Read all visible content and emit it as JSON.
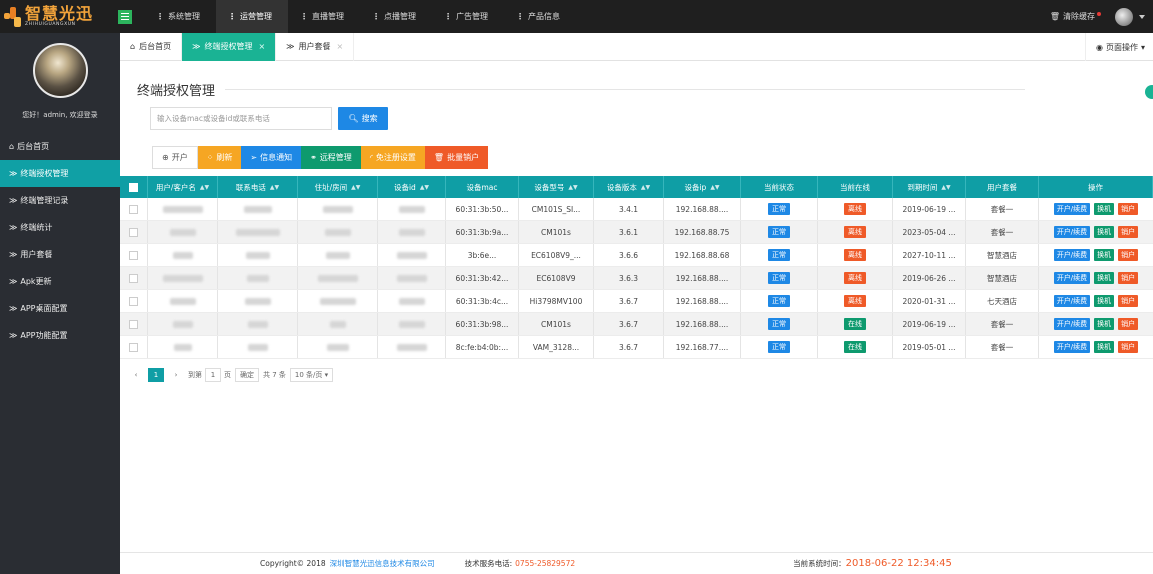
{
  "brand": {
    "name": "智慧光迅",
    "sub": "ZHIHUIGUANGXUN"
  },
  "topnav": [
    {
      "prefix": "⋮",
      "label": "系统管理"
    },
    {
      "prefix": "⋮",
      "label": "运营管理",
      "active": true
    },
    {
      "prefix": "⋮",
      "label": "直播管理"
    },
    {
      "prefix": "⋮",
      "label": "点播管理"
    },
    {
      "prefix": "⋮",
      "label": "广告管理"
    },
    {
      "prefix": "⋮",
      "label": "产品信息"
    }
  ],
  "topright": {
    "clear_cache": "清除缓存"
  },
  "sidebar": {
    "welcome": "您好！admin, 欢迎登录",
    "items": [
      {
        "icon": "home-icon",
        "label": "后台首页",
        "glyph": "⌂"
      },
      {
        "icon": "double-chevron-icon",
        "label": "终端授权管理",
        "glyph": "≫",
        "active": true
      },
      {
        "icon": "double-chevron-icon",
        "label": "终端管理记录",
        "glyph": "≫"
      },
      {
        "icon": "double-chevron-icon",
        "label": "终端统计",
        "glyph": "≫"
      },
      {
        "icon": "double-chevron-icon",
        "label": "用户套餐",
        "glyph": "≫"
      },
      {
        "icon": "double-chevron-icon",
        "label": "Apk更新",
        "glyph": "≫"
      },
      {
        "icon": "double-chevron-icon",
        "label": "APP桌面配置",
        "glyph": "≫"
      },
      {
        "icon": "double-chevron-icon",
        "label": "APP功能配置",
        "glyph": "≫"
      }
    ]
  },
  "tabs": {
    "home": "后台首页",
    "t1": "终端授权管理",
    "t2": "用户套餐",
    "close": "×",
    "page_ops": "页面操作"
  },
  "page": {
    "title": "终端授权管理",
    "search_placeholder": "输入设备mac或设备id或联系电话",
    "search_btn": "搜索"
  },
  "toolbar": {
    "open": "开户",
    "refresh": "刷新",
    "notify": "信息通知",
    "remote": "远程管理",
    "free": "免注册设置",
    "batch": "批量销户"
  },
  "table": {
    "headers": [
      "用户/客户名",
      "联系电话",
      "住址/房间",
      "设备id",
      "设备mac",
      "设备型号",
      "设备版本",
      "设备ip",
      "当前状态",
      "当前在线",
      "到期时间",
      "用户套餐",
      "操作"
    ],
    "rows": [
      {
        "mac": "60:31:3b:50...",
        "model": "CM101S_SI...",
        "ver": "3.4.1",
        "ip": "192.168.88....",
        "status": "正常",
        "online": "离线",
        "online_type": "off",
        "expire": "2019-06-19 ...",
        "plan": "套餐一"
      },
      {
        "mac": "60:31:3b:9a...",
        "model": "CM101s",
        "ver": "3.6.1",
        "ip": "192.168.88.75",
        "status": "正常",
        "online": "离线",
        "online_type": "off",
        "expire": "2023-05-04 ...",
        "plan": "套餐一"
      },
      {
        "mac": "3b:6e...",
        "model": "EC6108V9_...",
        "ver": "3.6.6",
        "ip": "192.168.88.68",
        "status": "正常",
        "online": "离线",
        "online_type": "off",
        "expire": "2027-10-11 ...",
        "plan": "智慧酒店"
      },
      {
        "mac": "60:31:3b:42...",
        "model": "EC6108V9",
        "ver": "3.6.3",
        "ip": "192.168.88....",
        "status": "正常",
        "online": "离线",
        "online_type": "off",
        "expire": "2019-06-26 ...",
        "plan": "智慧酒店"
      },
      {
        "mac": "60:31:3b:4c...",
        "model": "Hi3798MV100",
        "ver": "3.6.7",
        "ip": "192.168.88....",
        "status": "正常",
        "online": "离线",
        "online_type": "off",
        "expire": "2020-01-31 ...",
        "plan": "七天酒店"
      },
      {
        "mac": "60:31:3b:98...",
        "model": "CM101s",
        "ver": "3.6.7",
        "ip": "192.168.88....",
        "status": "正常",
        "online": "在线",
        "online_type": "on",
        "expire": "2019-06-19 ...",
        "plan": "套餐一"
      },
      {
        "mac": "8c:fe:b4:0b:...",
        "model": "VAM_3128...",
        "ver": "3.6.7",
        "ip": "192.168.77....",
        "status": "正常",
        "online": "在线",
        "online_type": "on",
        "expire": "2019-05-01 ...",
        "plan": "套餐一"
      }
    ],
    "actions": {
      "open": "开户/续费",
      "swap": "换机",
      "del": "销户"
    }
  },
  "pager": {
    "current": "1",
    "goto": "到第",
    "page_input": "1",
    "page_unit": "页",
    "confirm": "确定",
    "total": "共 7 条",
    "per_page": "10 条/页 ▾"
  },
  "footer": {
    "copyright": "Copyright© 2018",
    "company": "深圳智慧光迅信息技术有限公司",
    "support_label": "技术服务电话:",
    "phone": "0755-25829572",
    "time_label": "当前系统时间：",
    "time": "2018-06-22 12:34:45"
  }
}
